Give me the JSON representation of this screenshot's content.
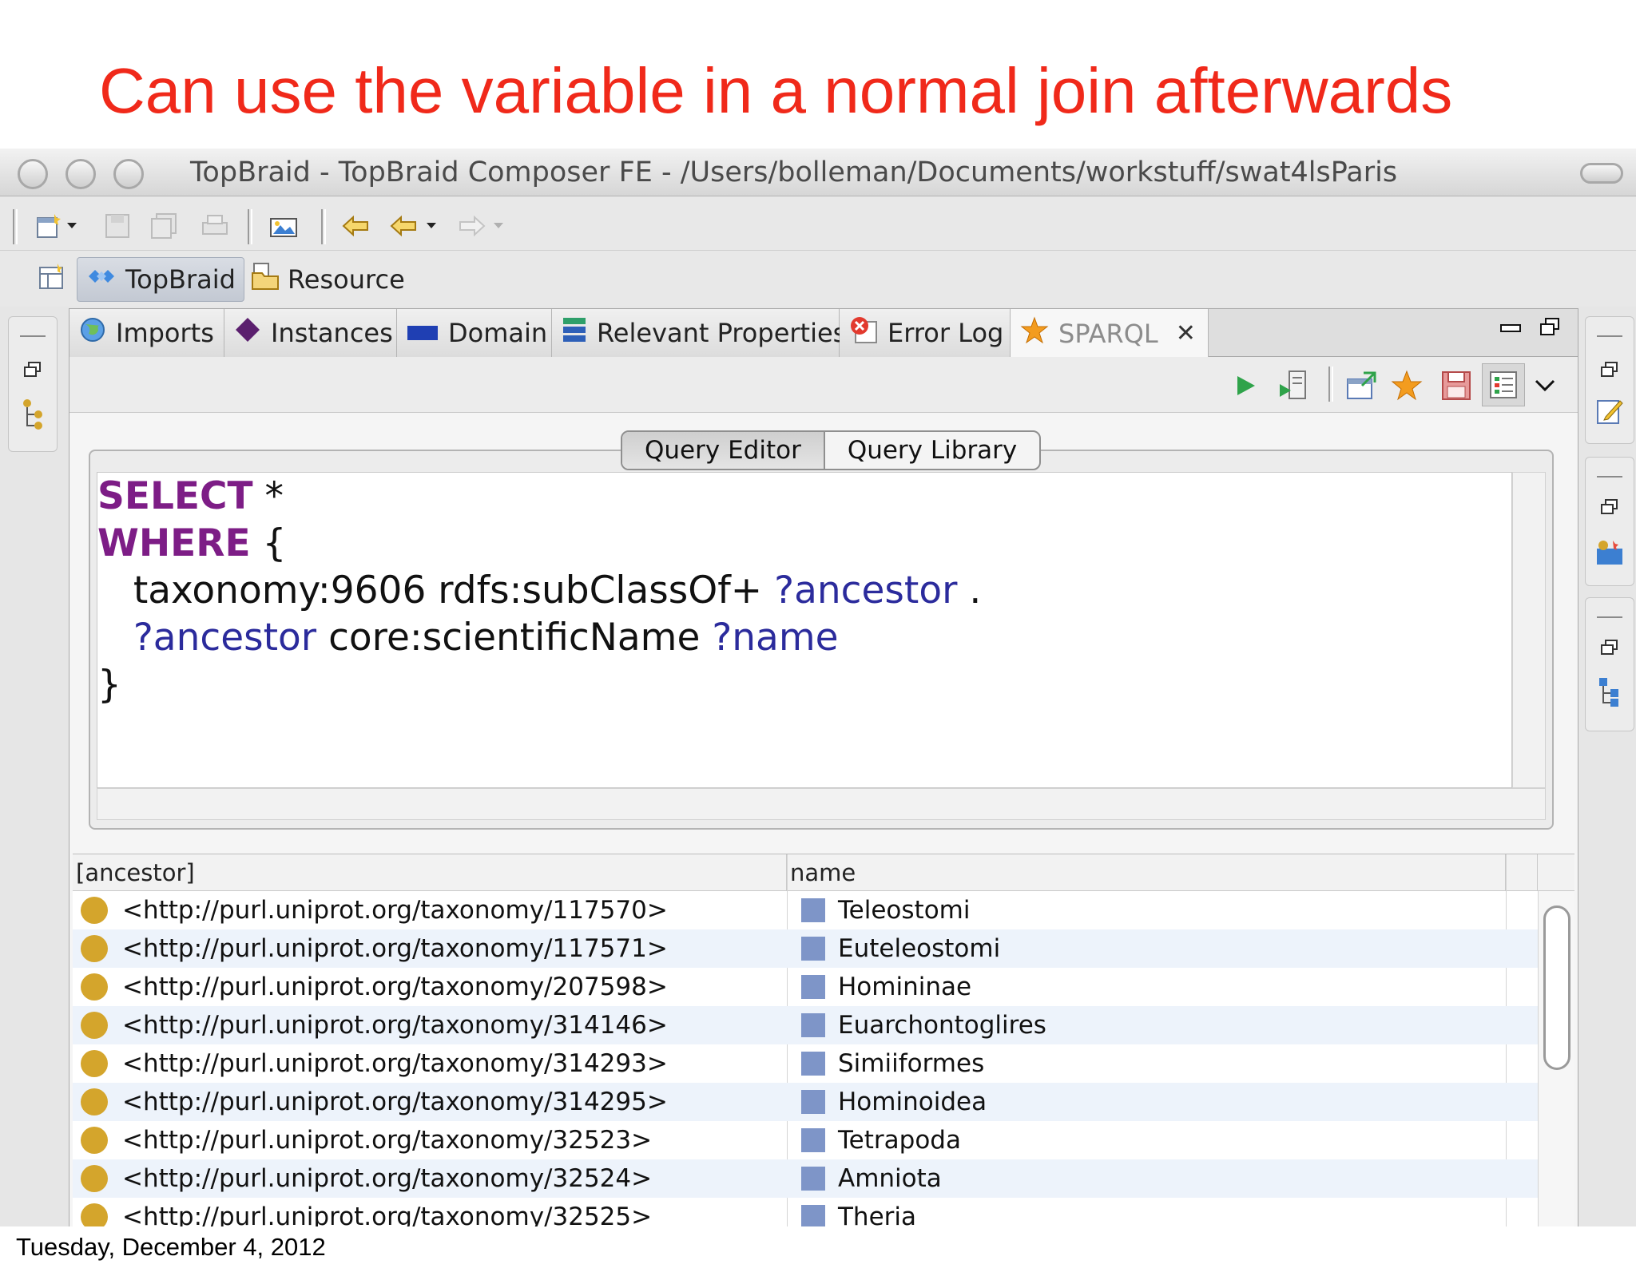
{
  "slide": {
    "title": "Can use the variable in a normal join afterwards",
    "footer_date": "Tuesday, December 4, 2012"
  },
  "window": {
    "title": "TopBraid - TopBraid Composer FE - /Users/bolleman/Documents/workstuff/swat4lsParis"
  },
  "perspectives": {
    "topbraid_label": "TopBraid",
    "resource_label": "Resource"
  },
  "tabs": [
    {
      "label": "Imports"
    },
    {
      "label": "Instances"
    },
    {
      "label": "Domain"
    },
    {
      "label": "Relevant Properties"
    },
    {
      "label": "Error Log"
    },
    {
      "label": "SPARQL"
    }
  ],
  "segmented": {
    "query_editor": "Query Editor",
    "query_library": "Query Library"
  },
  "query": {
    "select_kw": "SELECT",
    "select_rest": " *",
    "where_kw": "WHERE",
    "where_rest": " {",
    "line3_indent": "   ",
    "line3_text": "taxonomy:9606 rdfs:subClassOf+ ",
    "line3_var": "?ancestor",
    "line3_end": " .",
    "line4_indent": "   ",
    "line4_var1": "?ancestor",
    "line4_text": " core:scientificName ",
    "line4_var2": "?name",
    "line5": "}"
  },
  "results": {
    "columns": [
      "[ancestor]",
      "name"
    ],
    "rows": [
      {
        "ancestor": "<http://purl.uniprot.org/taxonomy/117570>",
        "name": "Teleostomi"
      },
      {
        "ancestor": "<http://purl.uniprot.org/taxonomy/117571>",
        "name": "Euteleostomi"
      },
      {
        "ancestor": "<http://purl.uniprot.org/taxonomy/207598>",
        "name": "Homininae"
      },
      {
        "ancestor": "<http://purl.uniprot.org/taxonomy/314146>",
        "name": "Euarchontoglires"
      },
      {
        "ancestor": "<http://purl.uniprot.org/taxonomy/314293>",
        "name": "Simiiformes"
      },
      {
        "ancestor": "<http://purl.uniprot.org/taxonomy/314295>",
        "name": "Hominoidea"
      },
      {
        "ancestor": "<http://purl.uniprot.org/taxonomy/32523>",
        "name": "Tetrapoda"
      },
      {
        "ancestor": "<http://purl.uniprot.org/taxonomy/32524>",
        "name": "Amniota"
      },
      {
        "ancestor": "<http://purl.uniprot.org/taxonomy/32525>",
        "name": "Theria"
      }
    ]
  },
  "colors": {
    "title_red": "#f0291a",
    "keyword_purple": "#7d1d86",
    "variable_blue": "#2b2b9c",
    "resource_dot": "#d4a52c",
    "literal_square": "#7e95c8"
  }
}
